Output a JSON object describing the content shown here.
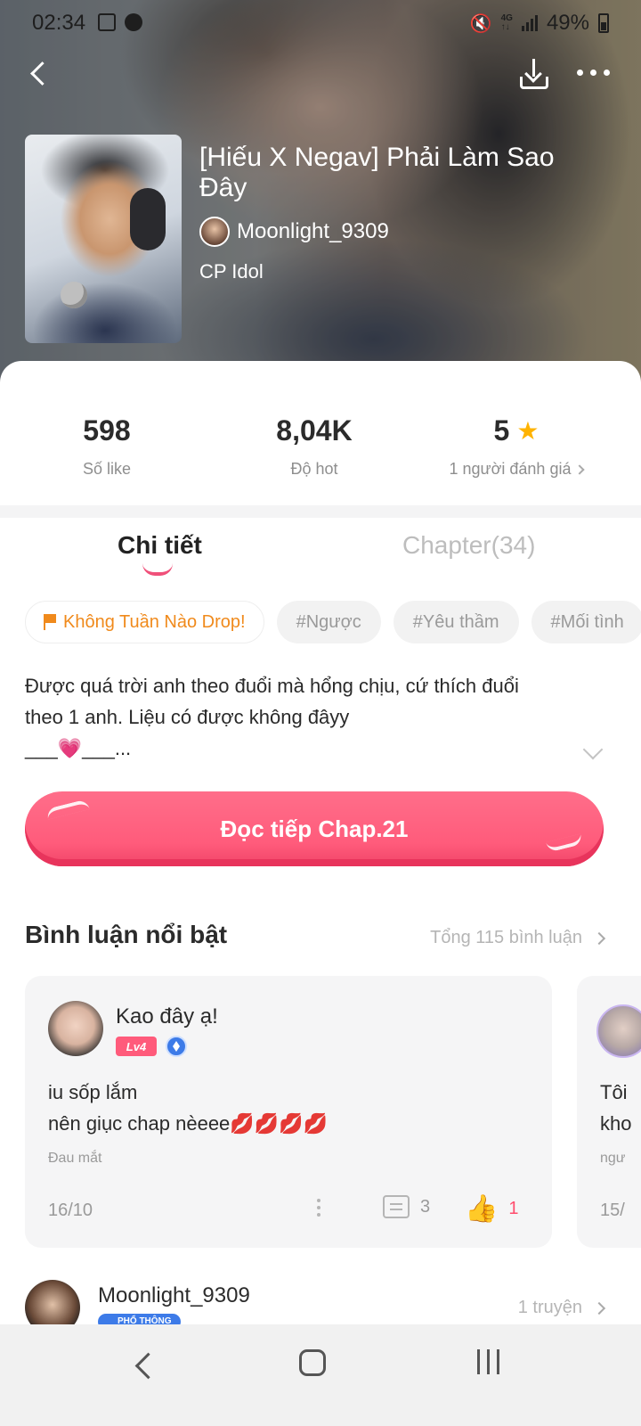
{
  "status_bar": {
    "time": "02:34",
    "battery": "49%"
  },
  "header": {
    "title": "[Hiếu X Negav] Phải Làm Sao Đây",
    "author": "Moonlight_9309",
    "genre": "CP Idol"
  },
  "stats": [
    {
      "value": "598",
      "label": "Số like"
    },
    {
      "value": "8,04K",
      "label": "Độ hot"
    },
    {
      "value": "5",
      "label": "1 người đánh giá"
    }
  ],
  "tabs": {
    "detail": "Chi tiết",
    "chapter": "Chapter(34)"
  },
  "tags": [
    "Không Tuần Nào Drop!",
    "#Ngược",
    "#Yêu thầm",
    "#Mối tình"
  ],
  "description": {
    "line1": "Được quá trời anh theo đuổi mà hổng chịu, cứ thích đuổi",
    "line2": "theo 1 anh. Liệu có được không đâyy",
    "line3_left": "___",
    "line3_right": "___..."
  },
  "read_button": "Đọc tiếp Chap.21",
  "comments_section": {
    "title": "Bình luận nổi bật",
    "total": "Tổng 115 bình luận"
  },
  "comments": [
    {
      "name": "Kao đây ạ!",
      "level": "Lv4",
      "line1": "iu sốp lắm",
      "line2": "nên giục chap nèeee",
      "lips": "💋💋💋💋",
      "chapter": "Đau mắt",
      "date": "16/10",
      "replies": "3",
      "likes": "1"
    },
    {
      "line1": "Tôi",
      "line2": "kho",
      "chapter": "ngư",
      "date": "15/"
    }
  ],
  "author_row": {
    "name": "Moonlight_9309",
    "badge": "PHỔ THÔNG",
    "count": "1 truyện"
  },
  "colors": {
    "accent": "#ff5b7b",
    "tag_special": "#f08a1c",
    "star": "#ffb300"
  }
}
